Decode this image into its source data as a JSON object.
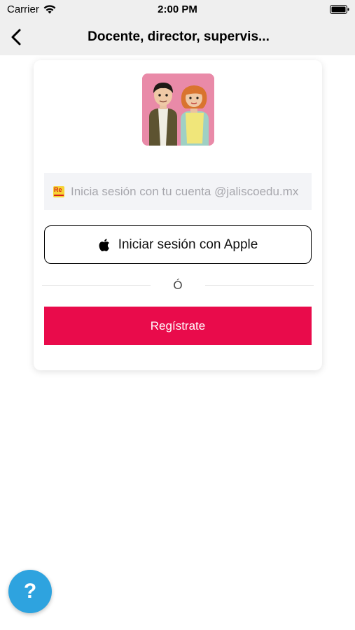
{
  "status_bar": {
    "carrier": "Carrier",
    "time": "2:00 PM"
  },
  "nav": {
    "title": "Docente, director, supervis..."
  },
  "login": {
    "google_label": "Inicia sesión con tu cuenta @jaliscoedu.mx",
    "google_logo_text": "Re",
    "apple_label": "Iniciar sesión con Apple",
    "divider_text": "Ó",
    "register_label": "Regístrate"
  },
  "help": {
    "label": "?"
  },
  "colors": {
    "primary": "#e90b4b",
    "help_button": "#2ea3df",
    "nav_background": "#efefef",
    "avatar_background": "#e98aa8"
  },
  "icons": [
    "wifi-icon",
    "battery-icon",
    "back-chevron-icon",
    "apple-icon",
    "app-logo-icon"
  ]
}
